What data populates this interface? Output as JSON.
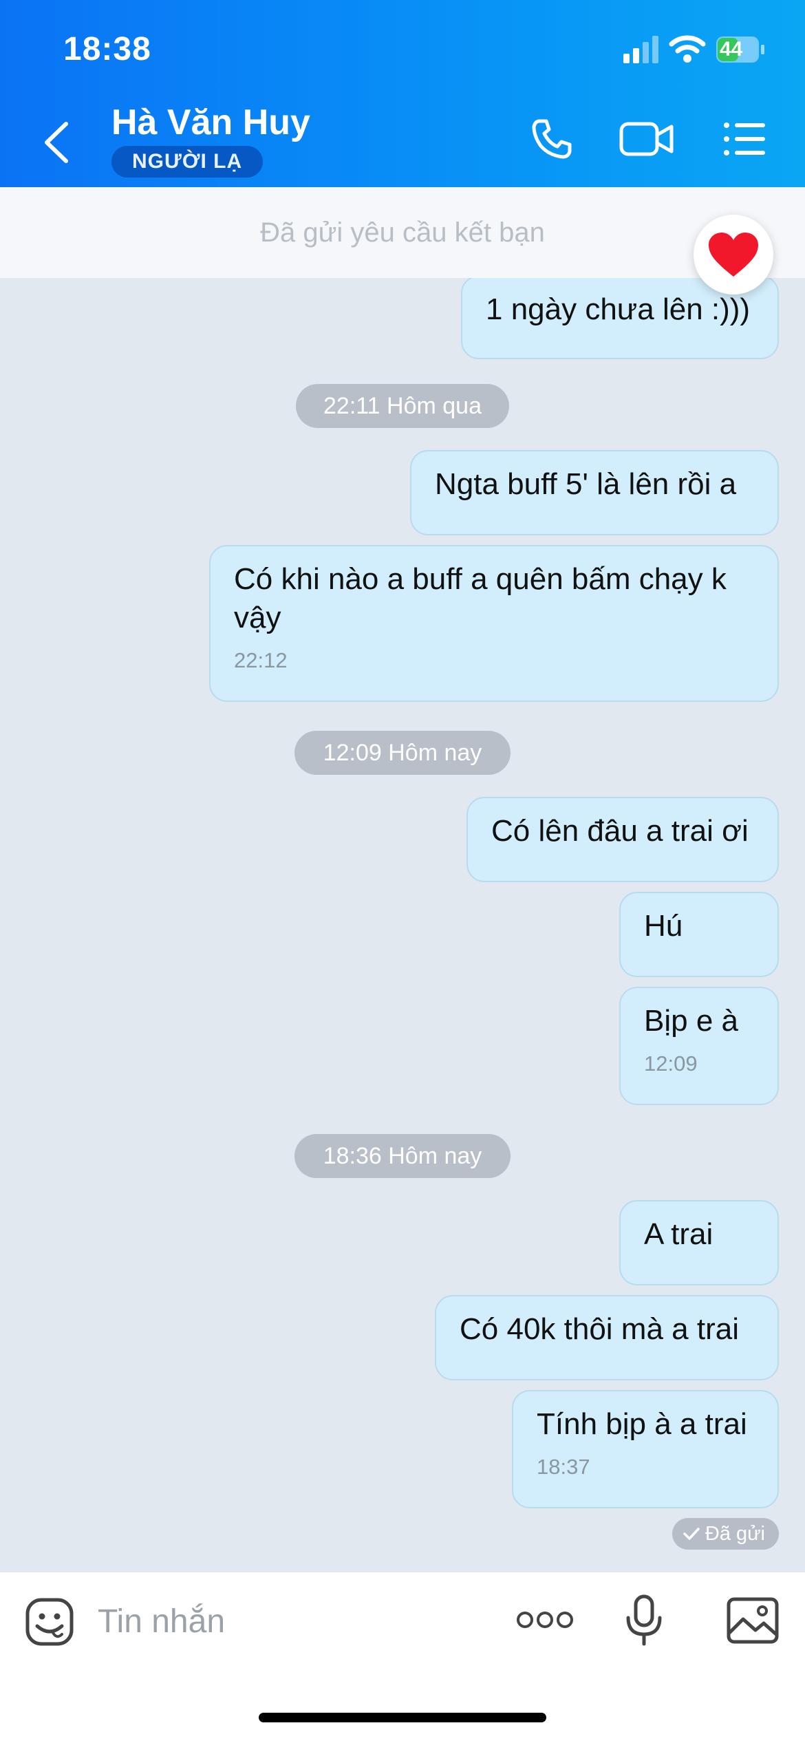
{
  "status_bar": {
    "time": "18:38",
    "battery": "44"
  },
  "header": {
    "contact_name": "Hà Văn Huy",
    "badge": "NGƯỜI LẠ",
    "icons": [
      "back-icon",
      "phone-icon",
      "video-icon",
      "menu-icon"
    ]
  },
  "request_bar": {
    "text": "Đã gửi yêu cầu kết bạn"
  },
  "messages": [
    {
      "text": "1 ngày chưa lên :)))"
    },
    {
      "stamp": "22:11 Hôm qua"
    },
    {
      "text": "Ngta buff 5' là lên rồi a"
    },
    {
      "text": "Có khi nào a buff a quên bấm chạy k vậy",
      "time": "22:12"
    },
    {
      "stamp": "12:09 Hôm nay"
    },
    {
      "text": "Có lên đâu a trai ơi"
    },
    {
      "text": "Hú"
    },
    {
      "text": "Bịp e à",
      "time": "12:09"
    },
    {
      "stamp": "18:36 Hôm nay"
    },
    {
      "text": "A trai"
    },
    {
      "text": "Có 40k thôi mà a trai"
    },
    {
      "text": "Tính bịp à a trai",
      "time": "18:37"
    }
  ],
  "sent_status": "Đã gửi",
  "input": {
    "placeholder": "Tin nhắn"
  },
  "colors": {
    "header_start": "#0a73f5",
    "header_end": "#0aa6f4",
    "bubble": "#d2edfb",
    "chat_bg": "#e2e8f0"
  }
}
